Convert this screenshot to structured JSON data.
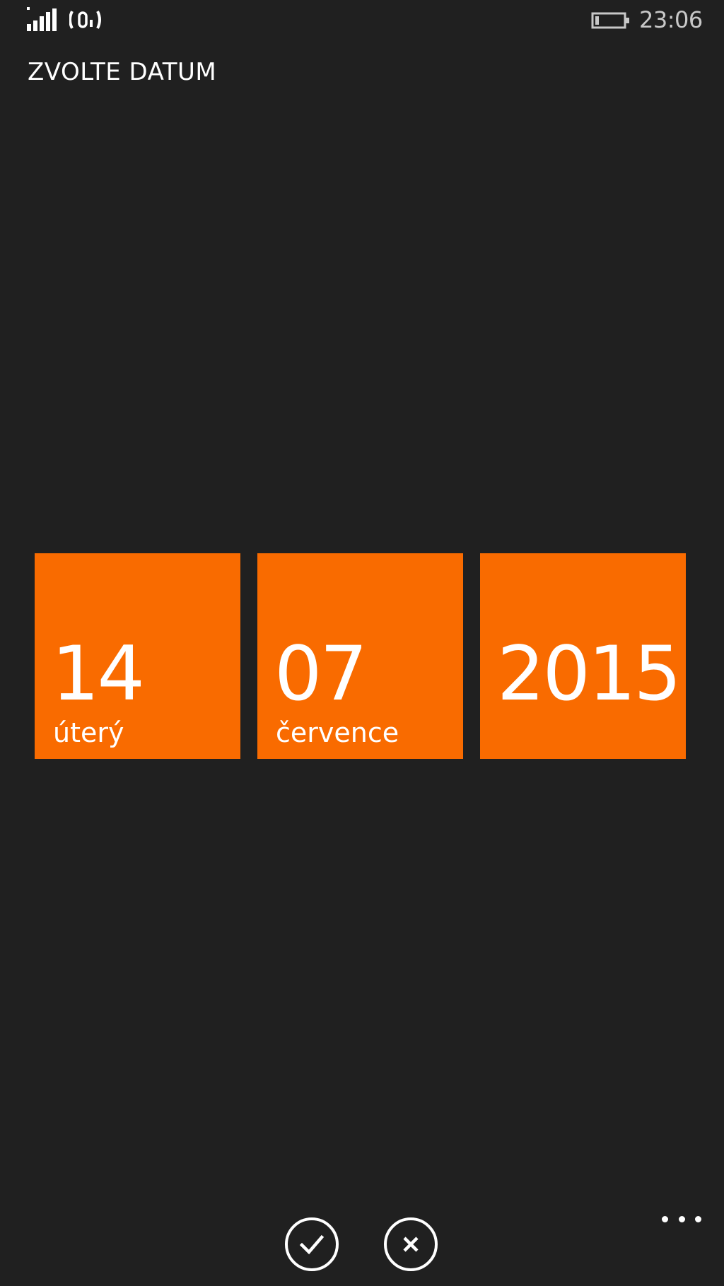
{
  "status_bar": {
    "time": "23:06",
    "signal_icon": "signal-strength-icon",
    "wifi_icon": "wifi-icon",
    "battery_icon": "battery-icon"
  },
  "title": "ZVOLTE DATUM",
  "date_picker": {
    "day": {
      "number": "14",
      "label": "úterý"
    },
    "month": {
      "number": "07",
      "label": "července"
    },
    "year": {
      "number": "2015"
    }
  },
  "app_bar": {
    "accept_icon": "checkmark-icon",
    "cancel_icon": "close-icon",
    "more_icon": "ellipsis-icon"
  },
  "colors": {
    "background": "#202020",
    "accent": "#f96b00",
    "foreground": "#ffffff"
  }
}
